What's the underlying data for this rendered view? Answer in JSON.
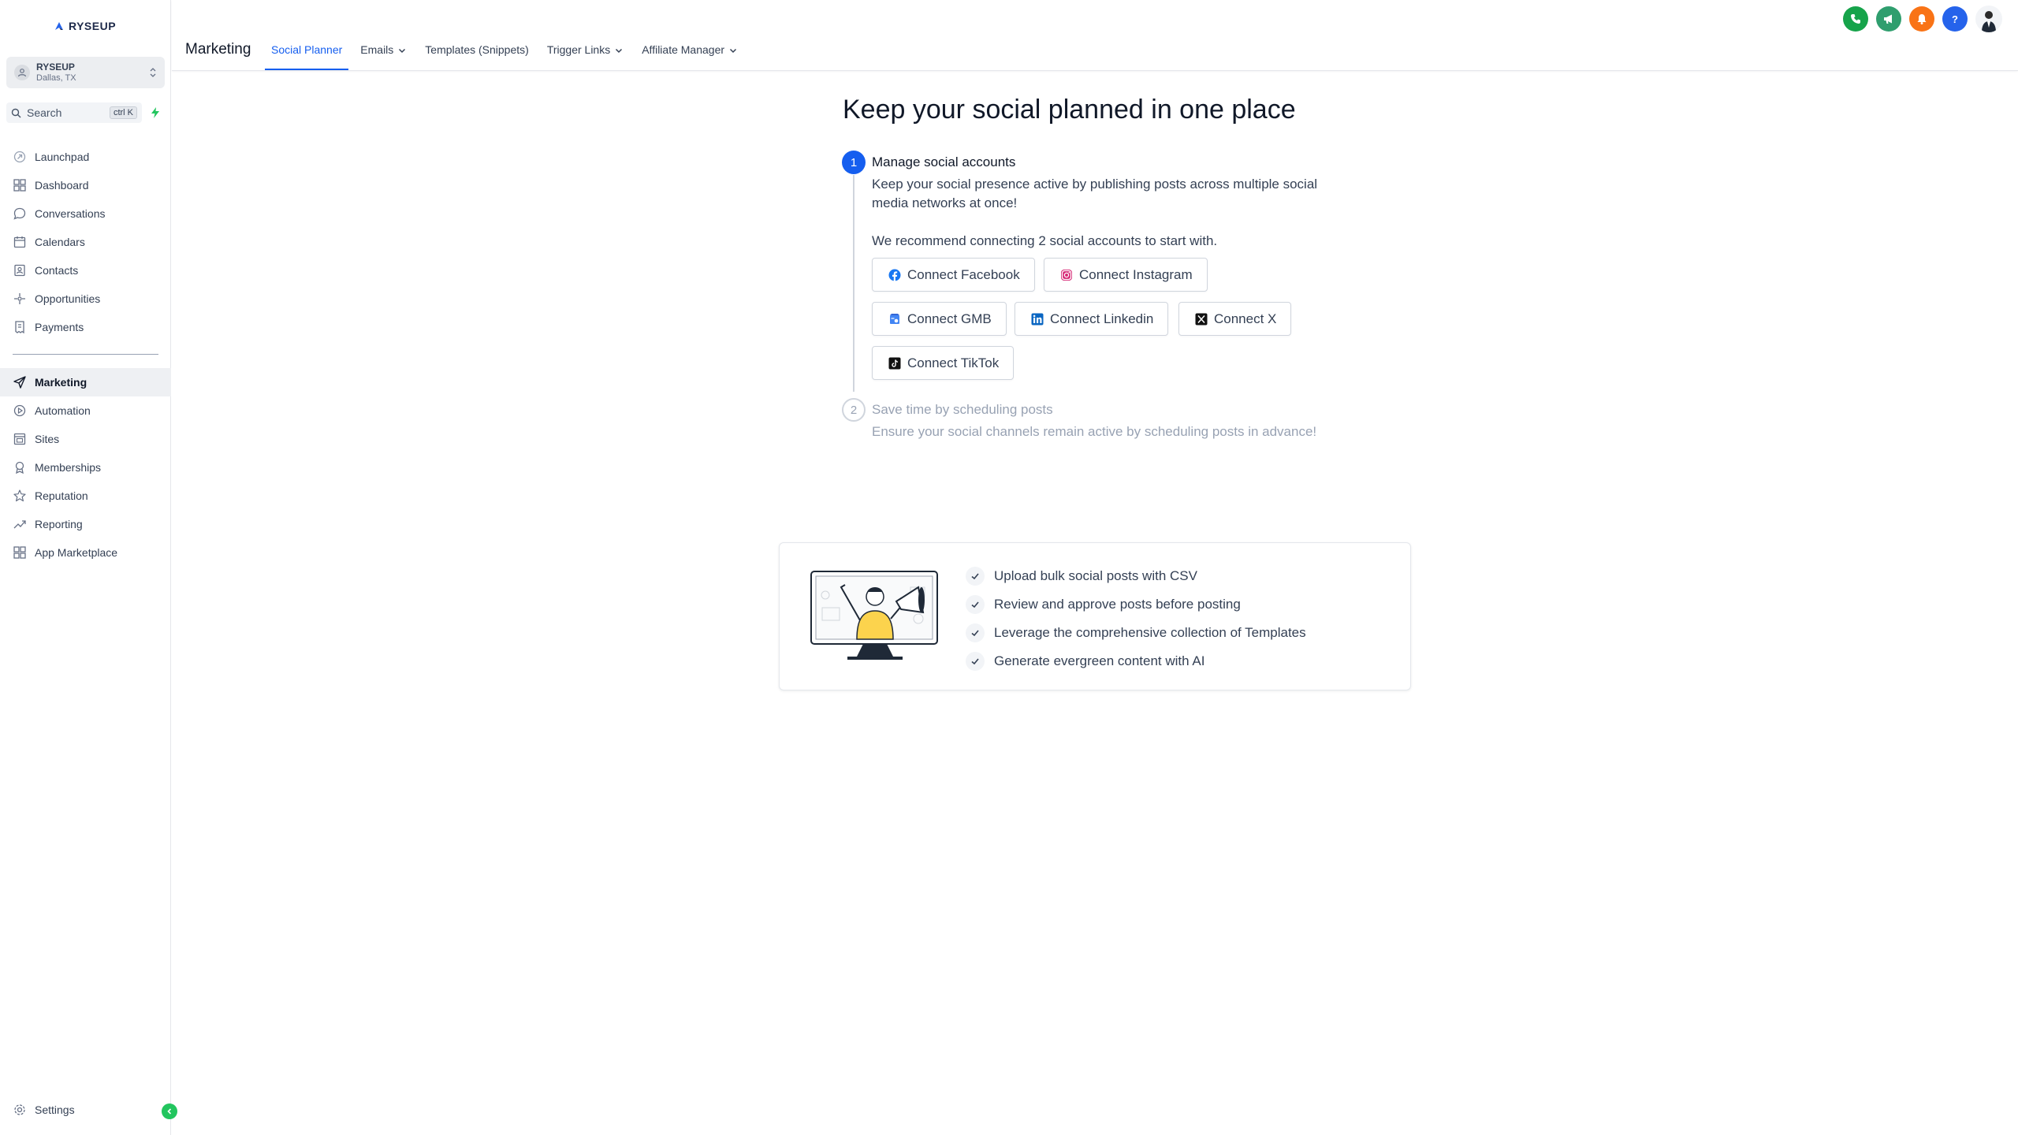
{
  "brand": {
    "name": "RYSEUP"
  },
  "account": {
    "name": "RYSEUP",
    "location": "Dallas, TX"
  },
  "search": {
    "label": "Search",
    "shortcut": "ctrl K"
  },
  "sidebar": {
    "items": [
      {
        "label": "Launchpad",
        "icon": "rocket-icon"
      },
      {
        "label": "Dashboard",
        "icon": "grid-icon"
      },
      {
        "label": "Conversations",
        "icon": "chat-icon"
      },
      {
        "label": "Calendars",
        "icon": "calendar-icon"
      },
      {
        "label": "Contacts",
        "icon": "contacts-icon"
      },
      {
        "label": "Opportunities",
        "icon": "pipeline-icon"
      },
      {
        "label": "Payments",
        "icon": "receipt-icon"
      }
    ],
    "items2": [
      {
        "label": "Marketing",
        "icon": "send-icon",
        "active": true
      },
      {
        "label": "Automation",
        "icon": "automation-icon"
      },
      {
        "label": "Sites",
        "icon": "sites-icon"
      },
      {
        "label": "Memberships",
        "icon": "award-icon"
      },
      {
        "label": "Reputation",
        "icon": "star-icon"
      },
      {
        "label": "Reporting",
        "icon": "trend-icon"
      },
      {
        "label": "App Marketplace",
        "icon": "apps-icon"
      }
    ],
    "settings": "Settings"
  },
  "header": {
    "title": "Marketing",
    "tabs": [
      {
        "label": "Social Planner",
        "active": true,
        "dropdown": false
      },
      {
        "label": "Emails",
        "dropdown": true
      },
      {
        "label": "Templates (Snippets)",
        "dropdown": false
      },
      {
        "label": "Trigger Links",
        "dropdown": true
      },
      {
        "label": "Affiliate Manager",
        "dropdown": true
      }
    ]
  },
  "topIcons": [
    {
      "name": "phone-icon",
      "color": "#16a34a"
    },
    {
      "name": "megaphone-icon",
      "color": "#2f9e6e"
    },
    {
      "name": "bell-icon",
      "color": "#f97316"
    },
    {
      "name": "help-icon",
      "color": "#2563eb"
    }
  ],
  "main": {
    "headline": "Keep your social planned in one place",
    "step1": {
      "number": "1",
      "title": "Manage social accounts",
      "description": "Keep your social presence active by publishing posts across multiple social media networks at once!",
      "recommend": "We recommend connecting 2 social accounts to start with.",
      "buttons": {
        "facebook": "Connect Facebook",
        "instagram": "Connect Instagram",
        "gmb": "Connect GMB",
        "linkedin": "Connect Linkedin",
        "x": "Connect X",
        "tiktok": "Connect TikTok"
      }
    },
    "step2": {
      "number": "2",
      "title": "Save time by scheduling posts",
      "description": "Ensure your social channels remain active by scheduling posts in advance!"
    },
    "features": [
      "Upload bulk social posts with CSV",
      "Review and approve posts before posting",
      "Leverage the comprehensive collection of Templates",
      "Generate evergreen content with AI"
    ]
  },
  "colors": {
    "accent": "#155eef",
    "activeTab": "#155eef",
    "collapse": "#22c55e"
  }
}
